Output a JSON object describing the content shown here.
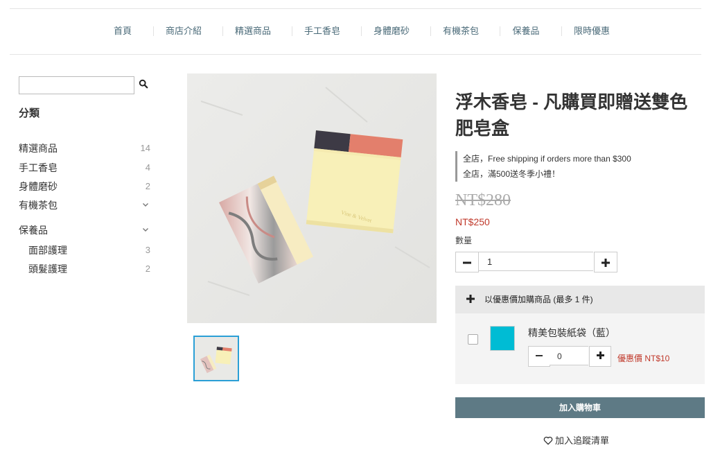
{
  "nav": {
    "items": [
      "首頁",
      "商店介紹",
      "精選商品",
      "手工香皂",
      "身體磨砂",
      "有機茶包",
      "保養品",
      "限時優惠"
    ]
  },
  "sidebar": {
    "search": {
      "value": "",
      "placeholder": ""
    },
    "title": "分類",
    "categories": [
      {
        "label": "精選商品",
        "count": "14"
      },
      {
        "label": "手工香皂",
        "count": "4"
      },
      {
        "label": "身體磨砂",
        "count": "2"
      },
      {
        "label": "有機茶包",
        "expandable": true
      },
      {
        "label": "保養品",
        "expandable": true
      }
    ],
    "subcategories": [
      {
        "label": "面部護理",
        "count": "3"
      },
      {
        "label": "頭髮護理",
        "count": "2"
      }
    ]
  },
  "product": {
    "title": "浮木香皂 - 凡購買即贈送雙色肥皂盒",
    "image_text": "Vine & Velvet",
    "promotions": [
      "全店，Free shipping if orders more than $300",
      "全店，滿500送冬季小禮！"
    ],
    "original_price": "NT$280",
    "price": "NT$250",
    "quantity_label": "數量",
    "quantity": "1"
  },
  "addon": {
    "header": "以優惠價加購商品 (最多 1 件)",
    "item_name": "精美包裝紙袋（藍）",
    "item_color": "#00bcd4",
    "quantity": "0",
    "price": "優惠價 NT$10"
  },
  "actions": {
    "add_to_cart": "加入購物車",
    "wishlist": "加入追蹤清單"
  },
  "colors": {
    "accent": "#5e7a85",
    "sale": "#c0392b",
    "nav_text": "#4a6a78"
  }
}
